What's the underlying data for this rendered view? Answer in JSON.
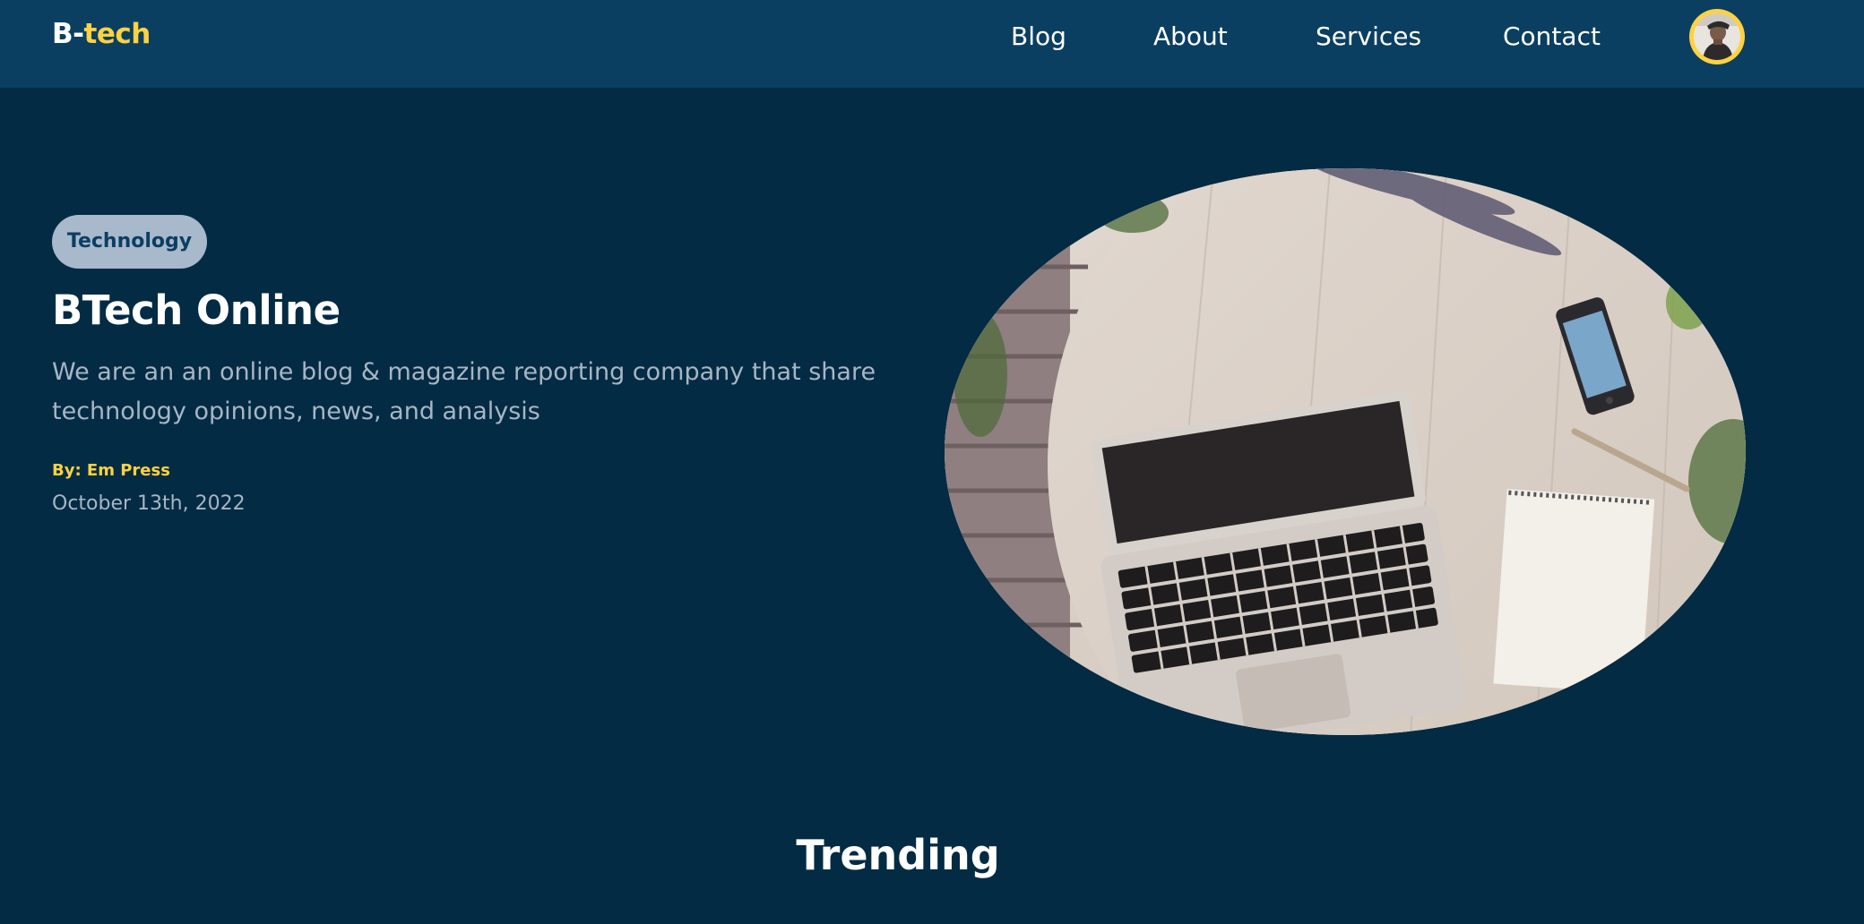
{
  "header": {
    "logo_prefix": "B-",
    "logo_accent": "tech",
    "nav": [
      "Blog",
      "About",
      "Services",
      "Contact"
    ],
    "avatar_icon": "user-avatar"
  },
  "hero": {
    "tag": "Technology",
    "title": "BTech Online",
    "description": "We are an an online blog & magazine reporting company that share technology opinions, news, and analysis",
    "author": "By: Em Press",
    "date": "October 13th, 2022",
    "image_icon": "laptop-desk-photo"
  },
  "trending": {
    "title": "Trending"
  },
  "colors": {
    "background": "#032b43",
    "navbar": "#0b3f61",
    "accent": "#ffd23f",
    "tag_bg": "#a8b9cc",
    "muted_text": "#a7b6c5"
  }
}
